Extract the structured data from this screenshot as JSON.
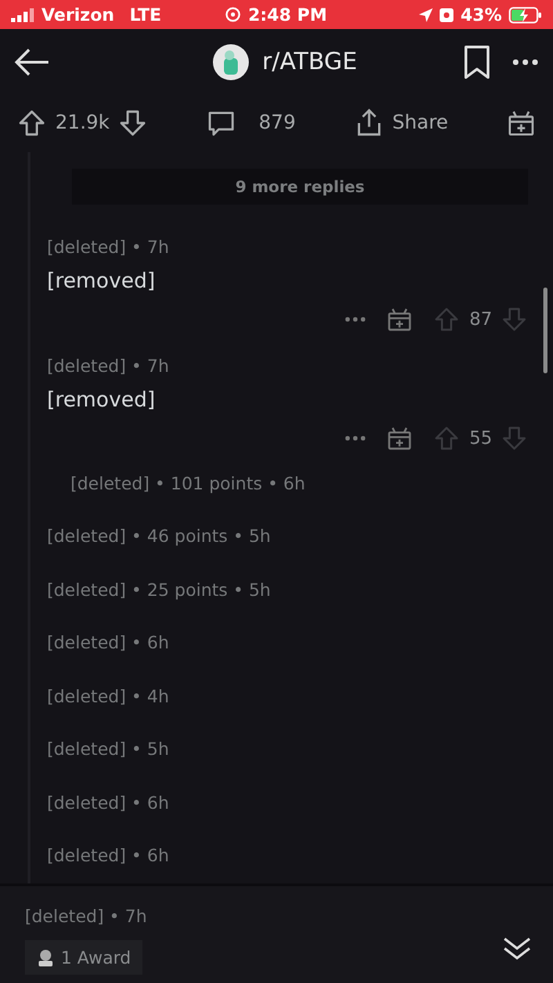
{
  "status_bar": {
    "carrier": "Verizon",
    "network": "LTE",
    "time": "2:48 PM",
    "battery": "43%",
    "charging": true
  },
  "header": {
    "title": "r/ATBGE"
  },
  "post_actions": {
    "score": "21.9k",
    "comments": "879",
    "share": "Share"
  },
  "more_replies": "9 more replies",
  "comments": [
    {
      "kind": "expanded",
      "meta": "[deleted] • 7h",
      "body": "[removed]",
      "score": "87"
    },
    {
      "kind": "expanded",
      "meta": "[deleted] • 7h",
      "body": "[removed]",
      "score": "55",
      "children": [
        {
          "kind": "collapsed",
          "meta": "[deleted] • 101 points • 6h"
        }
      ]
    },
    {
      "kind": "collapsed",
      "meta": "[deleted] • 46 points • 5h"
    },
    {
      "kind": "collapsed",
      "meta": "[deleted] • 25 points • 5h"
    },
    {
      "kind": "collapsed",
      "meta": "[deleted] • 6h"
    },
    {
      "kind": "collapsed",
      "meta": "[deleted] • 4h"
    },
    {
      "kind": "collapsed",
      "meta": "[deleted] • 5h"
    },
    {
      "kind": "collapsed",
      "meta": "[deleted] • 6h"
    },
    {
      "kind": "collapsed",
      "meta": "[deleted] • 6h"
    }
  ],
  "bottom_comment": {
    "meta": "[deleted] • 7h",
    "award": "1 Award"
  }
}
